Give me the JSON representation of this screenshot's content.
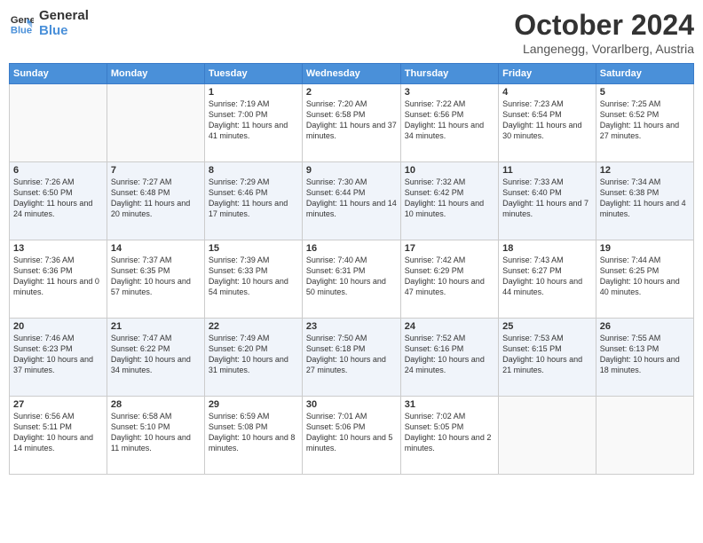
{
  "header": {
    "logo_line1": "General",
    "logo_line2": "Blue",
    "month": "October 2024",
    "location": "Langenegg, Vorarlberg, Austria"
  },
  "days_of_week": [
    "Sunday",
    "Monday",
    "Tuesday",
    "Wednesday",
    "Thursday",
    "Friday",
    "Saturday"
  ],
  "weeks": [
    [
      {
        "day": "",
        "sunrise": "",
        "sunset": "",
        "daylight": ""
      },
      {
        "day": "",
        "sunrise": "",
        "sunset": "",
        "daylight": ""
      },
      {
        "day": "1",
        "sunrise": "Sunrise: 7:19 AM",
        "sunset": "Sunset: 7:00 PM",
        "daylight": "Daylight: 11 hours and 41 minutes."
      },
      {
        "day": "2",
        "sunrise": "Sunrise: 7:20 AM",
        "sunset": "Sunset: 6:58 PM",
        "daylight": "Daylight: 11 hours and 37 minutes."
      },
      {
        "day": "3",
        "sunrise": "Sunrise: 7:22 AM",
        "sunset": "Sunset: 6:56 PM",
        "daylight": "Daylight: 11 hours and 34 minutes."
      },
      {
        "day": "4",
        "sunrise": "Sunrise: 7:23 AM",
        "sunset": "Sunset: 6:54 PM",
        "daylight": "Daylight: 11 hours and 30 minutes."
      },
      {
        "day": "5",
        "sunrise": "Sunrise: 7:25 AM",
        "sunset": "Sunset: 6:52 PM",
        "daylight": "Daylight: 11 hours and 27 minutes."
      }
    ],
    [
      {
        "day": "6",
        "sunrise": "Sunrise: 7:26 AM",
        "sunset": "Sunset: 6:50 PM",
        "daylight": "Daylight: 11 hours and 24 minutes."
      },
      {
        "day": "7",
        "sunrise": "Sunrise: 7:27 AM",
        "sunset": "Sunset: 6:48 PM",
        "daylight": "Daylight: 11 hours and 20 minutes."
      },
      {
        "day": "8",
        "sunrise": "Sunrise: 7:29 AM",
        "sunset": "Sunset: 6:46 PM",
        "daylight": "Daylight: 11 hours and 17 minutes."
      },
      {
        "day": "9",
        "sunrise": "Sunrise: 7:30 AM",
        "sunset": "Sunset: 6:44 PM",
        "daylight": "Daylight: 11 hours and 14 minutes."
      },
      {
        "day": "10",
        "sunrise": "Sunrise: 7:32 AM",
        "sunset": "Sunset: 6:42 PM",
        "daylight": "Daylight: 11 hours and 10 minutes."
      },
      {
        "day": "11",
        "sunrise": "Sunrise: 7:33 AM",
        "sunset": "Sunset: 6:40 PM",
        "daylight": "Daylight: 11 hours and 7 minutes."
      },
      {
        "day": "12",
        "sunrise": "Sunrise: 7:34 AM",
        "sunset": "Sunset: 6:38 PM",
        "daylight": "Daylight: 11 hours and 4 minutes."
      }
    ],
    [
      {
        "day": "13",
        "sunrise": "Sunrise: 7:36 AM",
        "sunset": "Sunset: 6:36 PM",
        "daylight": "Daylight: 11 hours and 0 minutes."
      },
      {
        "day": "14",
        "sunrise": "Sunrise: 7:37 AM",
        "sunset": "Sunset: 6:35 PM",
        "daylight": "Daylight: 10 hours and 57 minutes."
      },
      {
        "day": "15",
        "sunrise": "Sunrise: 7:39 AM",
        "sunset": "Sunset: 6:33 PM",
        "daylight": "Daylight: 10 hours and 54 minutes."
      },
      {
        "day": "16",
        "sunrise": "Sunrise: 7:40 AM",
        "sunset": "Sunset: 6:31 PM",
        "daylight": "Daylight: 10 hours and 50 minutes."
      },
      {
        "day": "17",
        "sunrise": "Sunrise: 7:42 AM",
        "sunset": "Sunset: 6:29 PM",
        "daylight": "Daylight: 10 hours and 47 minutes."
      },
      {
        "day": "18",
        "sunrise": "Sunrise: 7:43 AM",
        "sunset": "Sunset: 6:27 PM",
        "daylight": "Daylight: 10 hours and 44 minutes."
      },
      {
        "day": "19",
        "sunrise": "Sunrise: 7:44 AM",
        "sunset": "Sunset: 6:25 PM",
        "daylight": "Daylight: 10 hours and 40 minutes."
      }
    ],
    [
      {
        "day": "20",
        "sunrise": "Sunrise: 7:46 AM",
        "sunset": "Sunset: 6:23 PM",
        "daylight": "Daylight: 10 hours and 37 minutes."
      },
      {
        "day": "21",
        "sunrise": "Sunrise: 7:47 AM",
        "sunset": "Sunset: 6:22 PM",
        "daylight": "Daylight: 10 hours and 34 minutes."
      },
      {
        "day": "22",
        "sunrise": "Sunrise: 7:49 AM",
        "sunset": "Sunset: 6:20 PM",
        "daylight": "Daylight: 10 hours and 31 minutes."
      },
      {
        "day": "23",
        "sunrise": "Sunrise: 7:50 AM",
        "sunset": "Sunset: 6:18 PM",
        "daylight": "Daylight: 10 hours and 27 minutes."
      },
      {
        "day": "24",
        "sunrise": "Sunrise: 7:52 AM",
        "sunset": "Sunset: 6:16 PM",
        "daylight": "Daylight: 10 hours and 24 minutes."
      },
      {
        "day": "25",
        "sunrise": "Sunrise: 7:53 AM",
        "sunset": "Sunset: 6:15 PM",
        "daylight": "Daylight: 10 hours and 21 minutes."
      },
      {
        "day": "26",
        "sunrise": "Sunrise: 7:55 AM",
        "sunset": "Sunset: 6:13 PM",
        "daylight": "Daylight: 10 hours and 18 minutes."
      }
    ],
    [
      {
        "day": "27",
        "sunrise": "Sunrise: 6:56 AM",
        "sunset": "Sunset: 5:11 PM",
        "daylight": "Daylight: 10 hours and 14 minutes."
      },
      {
        "day": "28",
        "sunrise": "Sunrise: 6:58 AM",
        "sunset": "Sunset: 5:10 PM",
        "daylight": "Daylight: 10 hours and 11 minutes."
      },
      {
        "day": "29",
        "sunrise": "Sunrise: 6:59 AM",
        "sunset": "Sunset: 5:08 PM",
        "daylight": "Daylight: 10 hours and 8 minutes."
      },
      {
        "day": "30",
        "sunrise": "Sunrise: 7:01 AM",
        "sunset": "Sunset: 5:06 PM",
        "daylight": "Daylight: 10 hours and 5 minutes."
      },
      {
        "day": "31",
        "sunrise": "Sunrise: 7:02 AM",
        "sunset": "Sunset: 5:05 PM",
        "daylight": "Daylight: 10 hours and 2 minutes."
      },
      {
        "day": "",
        "sunrise": "",
        "sunset": "",
        "daylight": ""
      },
      {
        "day": "",
        "sunrise": "",
        "sunset": "",
        "daylight": ""
      }
    ]
  ]
}
